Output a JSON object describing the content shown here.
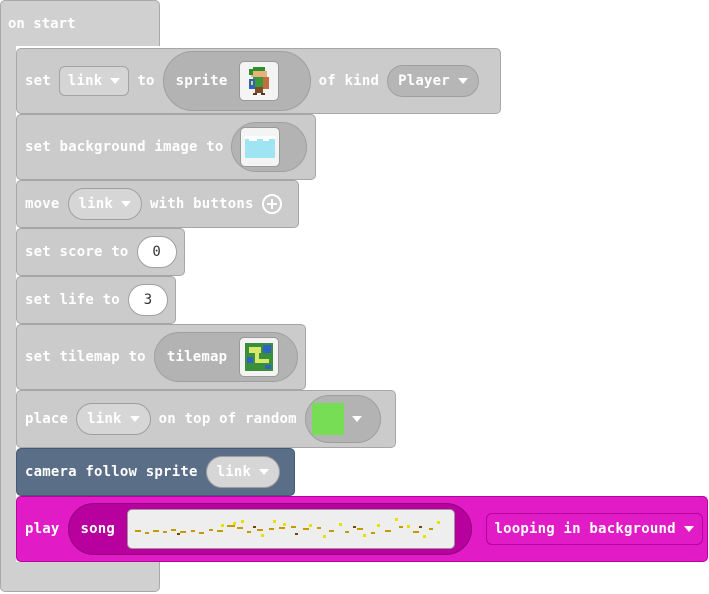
{
  "on_start": {
    "label": "on start"
  },
  "set_sprite": {
    "set": "set",
    "var": "link",
    "to": "to",
    "sprite": "sprite",
    "of_kind": "of kind",
    "kind": "Player",
    "image_icon": "link-character-icon"
  },
  "set_background": {
    "label": "set background image to",
    "image_icon": "sky-image-icon"
  },
  "move_buttons": {
    "move": "move",
    "var": "link",
    "with_buttons": "with buttons"
  },
  "set_score": {
    "label": "set score to",
    "value": "0"
  },
  "set_life": {
    "label": "set life to",
    "value": "3"
  },
  "set_tilemap": {
    "label": "set tilemap to",
    "tilemap": "tilemap",
    "image_icon": "tilemap-image-icon"
  },
  "place": {
    "place": "place",
    "var": "link",
    "on_top": "on top of random",
    "tile_color": "#77dd55"
  },
  "camera": {
    "label": "camera follow sprite",
    "var": "link"
  },
  "play": {
    "play": "play",
    "song": "song",
    "mode": "looping in background"
  },
  "colors": {
    "block": "#cbcbcb",
    "camera": "#5a6e87",
    "music": "#e11bc6",
    "music_border": "#b8009f"
  }
}
